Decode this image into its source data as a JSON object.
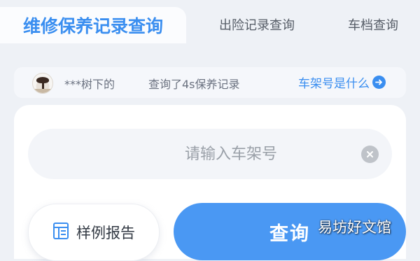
{
  "tabs": [
    {
      "label": "维修保养记录查询",
      "active": true
    },
    {
      "label": "出险记录查询",
      "active": false
    },
    {
      "label": "车档查询",
      "active": false
    }
  ],
  "ticker": {
    "user": "***树下的",
    "text": "查询了4s保养记录",
    "help_link": "车架号是什么",
    "help_icon": "arrow-right-circle-icon"
  },
  "search": {
    "placeholder": "请输入车架号",
    "value": "",
    "clear_icon": "close-circle-icon"
  },
  "actions": {
    "sample_report_label": "样例报告",
    "sample_report_icon": "report-icon",
    "query_label": "查询"
  },
  "watermark": "易坊好文馆",
  "colors": {
    "accent": "#3a8ef0",
    "query_button": "#4a98f3",
    "background": "#eef1f6"
  }
}
